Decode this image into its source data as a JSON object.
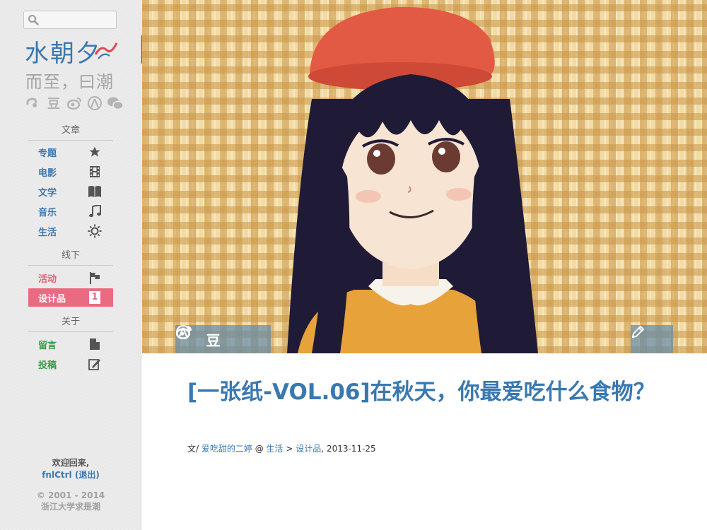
{
  "search": {
    "placeholder": ""
  },
  "brand": {
    "title": "水朝夕",
    "subtitle": "而至，曰潮"
  },
  "social": {
    "sidebar": [
      "douban",
      "weibo",
      "renren",
      "wechat"
    ],
    "douban_glyph": "豆"
  },
  "nav": {
    "sections": [
      {
        "heading": "文章"
      },
      {
        "heading": "线下"
      },
      {
        "heading": "关于"
      }
    ],
    "items": [
      {
        "label": "专题",
        "icon": "star-icon"
      },
      {
        "label": "电影",
        "icon": "film-icon"
      },
      {
        "label": "文学",
        "icon": "book-icon"
      },
      {
        "label": "音乐",
        "icon": "music-icon"
      },
      {
        "label": "生活",
        "icon": "sun-icon"
      },
      {
        "label": "活动",
        "icon": "flag-icon"
      },
      {
        "label": "设计品",
        "icon": "badge-one-icon",
        "badge": "1",
        "active": true
      },
      {
        "label": "留言",
        "icon": "document-icon"
      },
      {
        "label": "投稿",
        "icon": "edit-icon"
      }
    ]
  },
  "footer": {
    "welcome": "欢迎回来,",
    "username": "fnlCtrl",
    "logout": "(退出)",
    "copyright": "© 2001 - 2014",
    "org": "浙江大学求是潮"
  },
  "collapse": {
    "glyph": "<"
  },
  "article": {
    "title": "[一张纸-VOL.06]在秋天，你最爱吃什么食物？",
    "meta": {
      "prefix": "文/",
      "author": "爱吃甜的二婷",
      "at": "@",
      "category": "生活",
      "sep": ">",
      "subcategory": "设计品",
      "date_sep": ",",
      "date": "2013-11-25"
    }
  },
  "colors": {
    "accent": "#3a78b0",
    "active_bg": "#ea6a82",
    "activity_red": "#e8607a",
    "green": "#3a9a4a"
  }
}
